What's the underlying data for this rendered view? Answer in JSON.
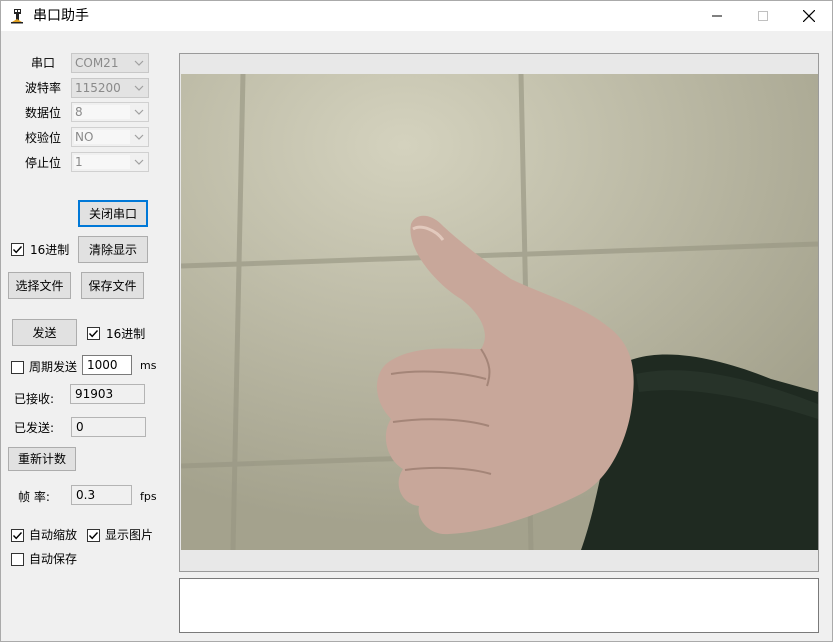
{
  "window": {
    "title": "串口助手",
    "icon": "serial-app-icon",
    "controls": [
      "minimize-icon",
      "maximize-icon",
      "close-icon"
    ]
  },
  "settings": {
    "port_label": "串口",
    "port_value": "COM21",
    "baud_label": "波特率",
    "baud_value": "115200",
    "databits_label": "数据位",
    "databits_value": "8",
    "parity_label": "校验位",
    "parity_value": "NO",
    "stopbits_label": "停止位",
    "stopbits_value": "1"
  },
  "actions": {
    "close_port": "关闭串口",
    "hex_receive_label": "16进制",
    "hex_receive_checked": true,
    "clear_display": "清除显示",
    "select_file": "选择文件",
    "save_file": "保存文件",
    "send": "发送",
    "hex_send_label": "16进制",
    "hex_send_checked": true,
    "periodic_send_label": "周期发送",
    "periodic_send_checked": false,
    "period_value": "1000",
    "period_unit": "ms"
  },
  "counters": {
    "received_label": "已接收:",
    "received_value": "91903",
    "sent_label": "已发送:",
    "sent_value": "0",
    "reset": "重新计数",
    "fps_label": "帧 率:",
    "fps_value": "0.3",
    "fps_unit": "fps"
  },
  "options": {
    "auto_zoom_label": "自动缩放",
    "auto_zoom_checked": true,
    "show_image_label": "显示图片",
    "show_image_checked": true,
    "auto_save_label": "自动保存",
    "auto_save_checked": false
  },
  "colors": {
    "focus_accent": "#0078d7",
    "button_face": "#e1e1e1",
    "window_bg": "#f0f0f0"
  }
}
